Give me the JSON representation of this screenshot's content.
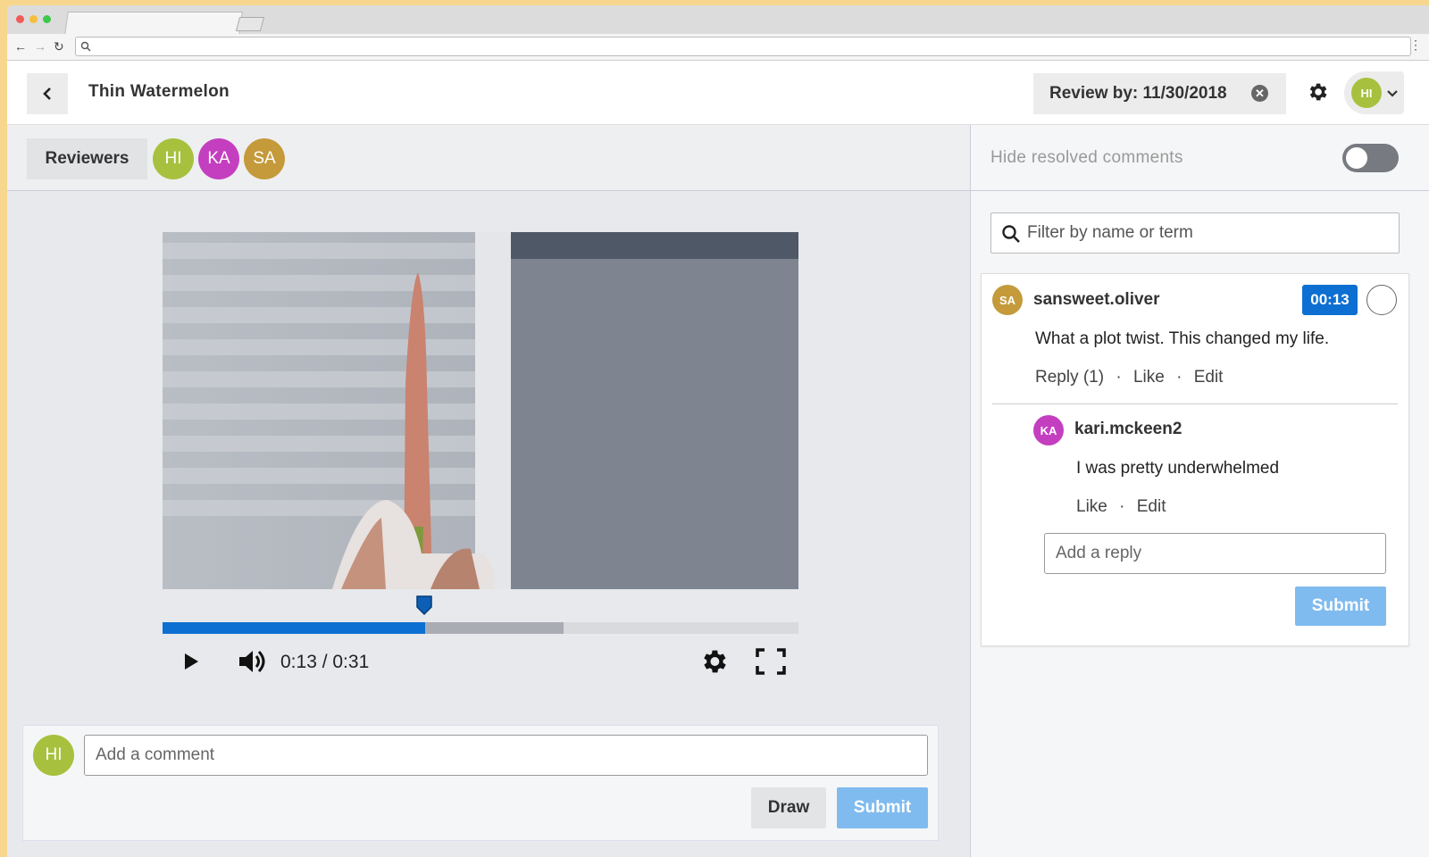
{
  "header": {
    "title": "Thin Watermelon",
    "review_by": "Review by: 11/30/2018",
    "user_initials": "HI"
  },
  "reviewers": {
    "label": "Reviewers",
    "avatars": [
      {
        "initials": "HI",
        "color": "#a7c13e"
      },
      {
        "initials": "KA",
        "color": "#c43fc0"
      },
      {
        "initials": "SA",
        "color": "#c49a3a"
      }
    ]
  },
  "player": {
    "time": "0:13 / 0:31",
    "played_fraction": 0.413,
    "buffered_fraction": 0.63,
    "accent": "#0d6fd1"
  },
  "new_comment": {
    "avatar": "HI",
    "placeholder": "Add a comment",
    "draw_label": "Draw",
    "submit_label": "Submit"
  },
  "sidebar": {
    "hide_resolved_label": "Hide resolved comments",
    "hide_resolved_on": false,
    "filter_placeholder": "Filter by name or term"
  },
  "thread": {
    "comment": {
      "avatar": "SA",
      "author": "sansweet.oliver",
      "timestamp": "00:13",
      "text": "What a plot twist. This changed my life.",
      "reply_label": "Reply (1)",
      "like_label": "Like",
      "edit_label": "Edit",
      "sep": "·"
    },
    "reply": {
      "avatar": "KA",
      "author": "kari.mckeen2",
      "text": "I was pretty underwhelmed",
      "like_label": "Like",
      "edit_label": "Edit",
      "sep": "·"
    },
    "reply_placeholder": "Add a reply",
    "submit_label": "Submit"
  }
}
